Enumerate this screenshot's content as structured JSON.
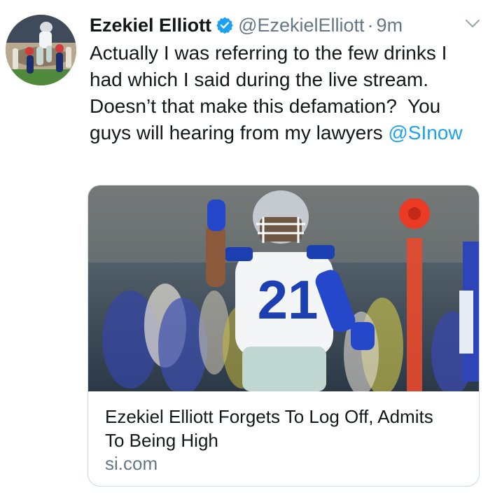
{
  "tweet": {
    "author_name": "Ezekiel Elliott",
    "handle": "@EzekielElliott",
    "separator": "·",
    "time": "9m",
    "text_before_mention": "Actually I was referring to the few drinks I had which I said during the live stream.  Doesn’t that make this defamation?  You guys will hearing from my lawyers ",
    "mention": "@SInow"
  },
  "card": {
    "title": "Ezekiel Elliott Forgets To Log Off, Admits To Being High",
    "domain": "si.com",
    "jersey_number": "21"
  },
  "icons": {
    "verified": "verified-badge-icon",
    "more": "chevron-down-icon"
  },
  "colors": {
    "link_blue": "#1da1f2",
    "secondary_text": "#657786",
    "primary_text": "#14171a",
    "border": "#cfd9de"
  }
}
